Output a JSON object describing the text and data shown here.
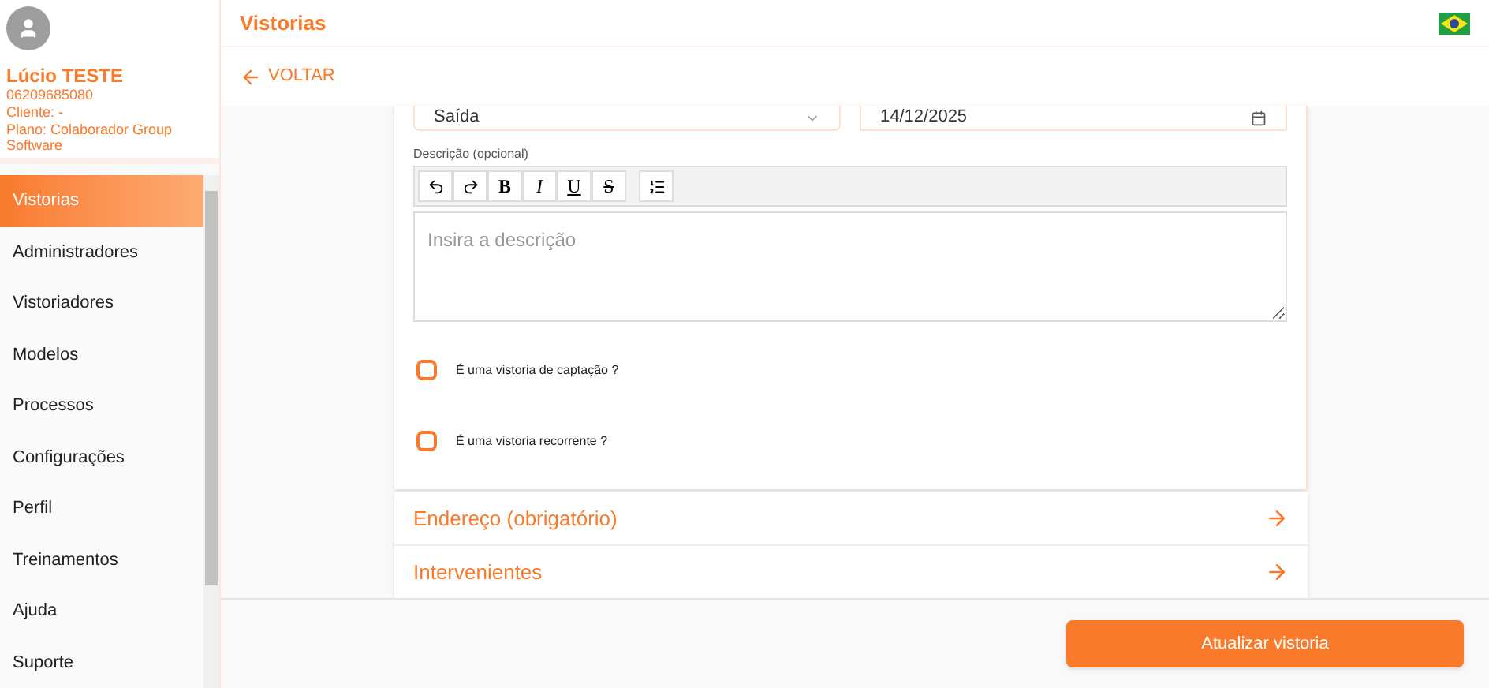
{
  "profile": {
    "name": "Lúcio TESTE",
    "document": "06209685080",
    "client": "Cliente: -",
    "plan": "Plano: Colaborador Group Software"
  },
  "sidebar": {
    "items": [
      {
        "label": "Vistorias",
        "selected": true
      },
      {
        "label": "Administradores",
        "selected": false
      },
      {
        "label": "Vistoriadores",
        "selected": false
      },
      {
        "label": "Modelos",
        "selected": false
      },
      {
        "label": "Processos",
        "selected": false
      },
      {
        "label": "Configurações",
        "selected": false
      },
      {
        "label": "Perfil",
        "selected": false
      },
      {
        "label": "Treinamentos",
        "selected": false
      },
      {
        "label": "Ajuda",
        "selected": false
      },
      {
        "label": "Suporte",
        "selected": false
      }
    ]
  },
  "header": {
    "title": "Vistorias"
  },
  "back": {
    "label": "VOLTAR"
  },
  "form": {
    "type_field": {
      "value": "Saída"
    },
    "date_field": {
      "value": "14/12/2025"
    },
    "description": {
      "label": "Descrição (opcional)",
      "placeholder": "Insira a descrição",
      "toolbar": [
        {
          "kind": "undo"
        },
        {
          "kind": "redo"
        },
        {
          "kind": "bold",
          "text": "B"
        },
        {
          "kind": "italic",
          "text": "I"
        },
        {
          "kind": "underline",
          "text": "U"
        },
        {
          "kind": "strike",
          "text": "S"
        },
        {
          "kind": "list"
        }
      ]
    },
    "checkboxes": [
      {
        "label": "É uma vistoria de captação ?",
        "checked": false
      },
      {
        "label": "É uma vistoria recorrente ?",
        "checked": false
      }
    ]
  },
  "sections": [
    {
      "label": "Endereço (obrigatório)"
    },
    {
      "label": "Intervenientes"
    }
  ],
  "submit": {
    "label": "Atualizar vistoria"
  }
}
